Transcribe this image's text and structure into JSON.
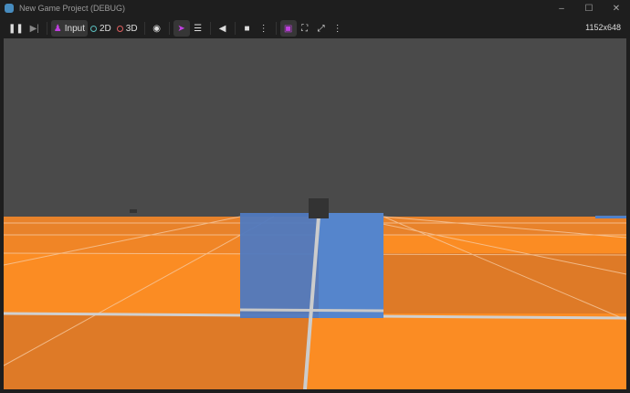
{
  "window": {
    "title": "New Game Project (DEBUG)",
    "minimize": "–",
    "maximize": "☐",
    "close": "✕"
  },
  "toolbar": {
    "input_label": "Input",
    "2d_label": "2D",
    "3d_label": "3D",
    "resolution": "1152x648"
  },
  "colors": {
    "sky": "#4a4a4a",
    "floor_light": "#fb8c23",
    "floor_dark": "#de7a27",
    "box": "#5080c8",
    "accent": "#c040e0"
  }
}
